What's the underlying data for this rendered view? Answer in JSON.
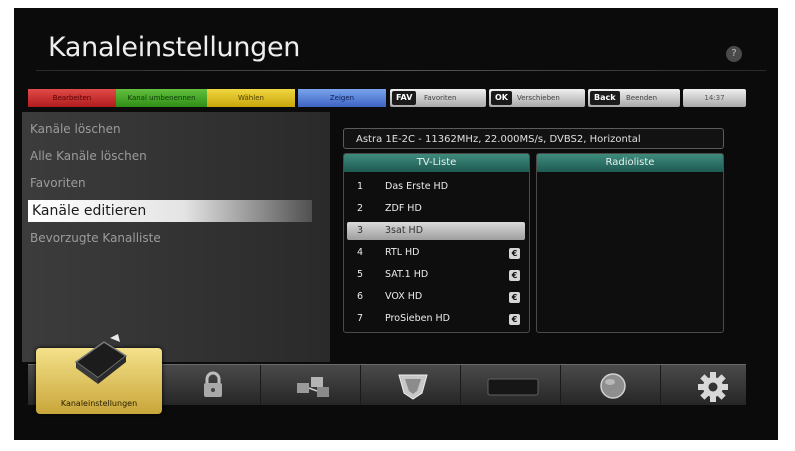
{
  "header": {
    "title": "Kanaleinstellungen",
    "help": "?"
  },
  "keys": {
    "red": "Bearbeiten",
    "green": "Kanal umbenennen",
    "yellow": "Wählen",
    "blue": "Zeigen",
    "fav": {
      "tag": "FAV",
      "label": "Favoriten"
    },
    "ok": {
      "tag": "OK",
      "label": "Verschieben"
    },
    "back": {
      "tag": "Back",
      "label": "Beenden"
    },
    "clock": "14:37"
  },
  "menu": {
    "items": [
      {
        "label": "Kanäle löschen"
      },
      {
        "label": "Alle Kanäle löschen"
      },
      {
        "label": "Favoriten"
      },
      {
        "label": "Kanäle editieren"
      },
      {
        "label": "Bevorzugte Kanalliste"
      }
    ],
    "active_index": 3
  },
  "transponder": "Astra 1E-2C - 11362MHz, 22.000MS/s, DVBS2, Horizontal",
  "tv_list": {
    "title": "TV-Liste",
    "channels": [
      {
        "num": "1",
        "name": "Das Erste HD",
        "hd": ""
      },
      {
        "num": "2",
        "name": "ZDF HD",
        "hd": ""
      },
      {
        "num": "3",
        "name": "3sat HD",
        "hd": ""
      },
      {
        "num": "4",
        "name": "RTL HD",
        "hd": "€"
      },
      {
        "num": "5",
        "name": "SAT.1 HD",
        "hd": "€"
      },
      {
        "num": "6",
        "name": "VOX HD",
        "hd": "€"
      },
      {
        "num": "7",
        "name": "ProSieben HD",
        "hd": "€"
      }
    ],
    "selected_index": 2
  },
  "radio_list": {
    "title": "Radioliste"
  },
  "bottom": {
    "active_label": "Kanaleinstellungen",
    "tiles": [
      "lock-icon",
      "network-icon",
      "shield-icon",
      "tv-icon",
      "globe-icon",
      "gear-icon"
    ]
  }
}
